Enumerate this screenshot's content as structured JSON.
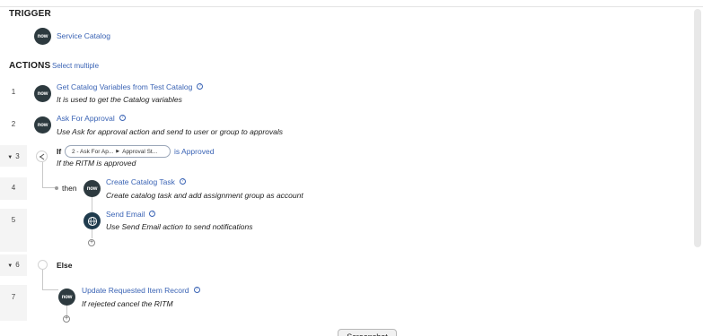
{
  "trigger": {
    "heading": "TRIGGER",
    "item": {
      "icon": "now-logo-icon",
      "avatar_text": "now",
      "label": "Service Catalog"
    }
  },
  "actions": {
    "heading": "ACTIONS",
    "select_multiple": "Select multiple",
    "steps": [
      {
        "number": "1",
        "avatar_text": "now",
        "title": "Get Catalog Variables from Test Catalog",
        "description": "It is used to get the Catalog variables"
      },
      {
        "number": "2",
        "avatar_text": "now",
        "title": "Ask For Approval",
        "description": "Use Ask for approval action and send to user or group to approvals"
      },
      {
        "number": "3",
        "keyword": "If",
        "pill_left": "2 - Ask For Ap...",
        "pill_right": "Approval St...",
        "condition": "is Approved",
        "description": "If the RITM is approved"
      },
      {
        "number": "4",
        "branch_label": "then",
        "avatar_text": "now",
        "title": "Create Catalog Task",
        "description": "Create catalog task and add assignment group as account"
      },
      {
        "number": "5",
        "icon": "globe-icon",
        "title": "Send Email",
        "description": "Use Send Email action to send notifications"
      },
      {
        "number": "6",
        "keyword": "Else"
      },
      {
        "number": "7",
        "avatar_text": "now",
        "title": "Update Requested Item Record",
        "description": "If rejected cancel the RITM"
      }
    ]
  },
  "footer": {
    "screenshot_button": "Screenshot"
  }
}
